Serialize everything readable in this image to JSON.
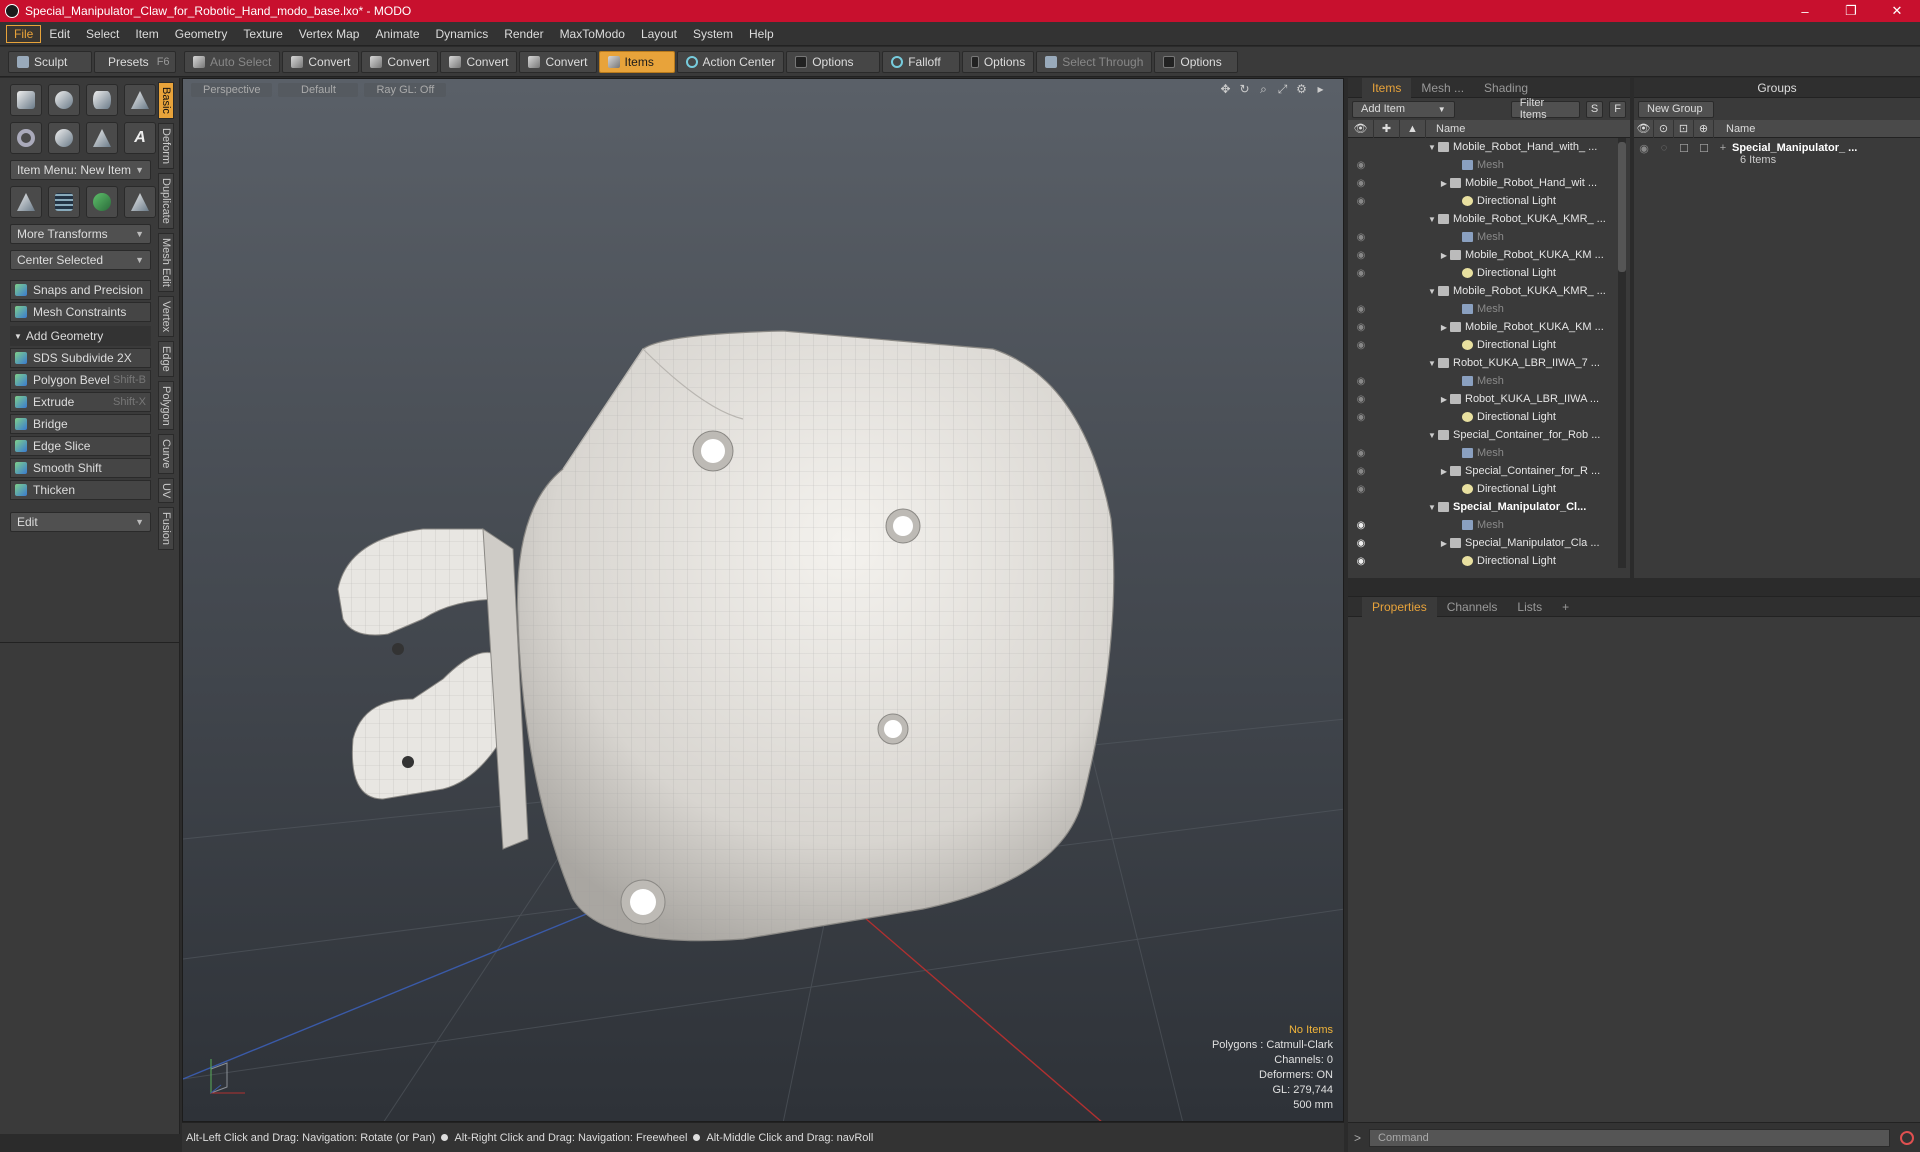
{
  "window": {
    "title": "Special_Manipulator_Claw_for_Robotic_Hand_modo_base.lxo* - MODO",
    "controls": [
      "–",
      "❐",
      "✕"
    ]
  },
  "menu": [
    "File",
    "Edit",
    "Select",
    "Item",
    "Geometry",
    "Texture",
    "Vertex Map",
    "Animate",
    "Dynamics",
    "Render",
    "MaxToModo",
    "Layout",
    "System",
    "Help"
  ],
  "toolbar": {
    "sculpt": "Sculpt",
    "presets": "Presets",
    "presets_key": "F6",
    "auto_select": "Auto Select",
    "convert1": "Convert",
    "convert2": "Convert",
    "convert3": "Convert",
    "convert4": "Convert",
    "items": "Items",
    "action_center": "Action Center",
    "options1": "Options",
    "falloff": "Falloff",
    "options2": "Options",
    "select_through": "Select Through",
    "options3": "Options"
  },
  "left": {
    "item_menu": "Item Menu: New Item",
    "more_transforms": "More Transforms",
    "center_selected": "Center Selected",
    "snaps": "Snaps and Precision",
    "mesh_constraints": "Mesh Constraints",
    "add_geometry": "Add Geometry",
    "tools": [
      {
        "label": "SDS Subdivide 2X",
        "key": ""
      },
      {
        "label": "Polygon Bevel",
        "key": "Shift-B"
      },
      {
        "label": "Extrude",
        "key": "Shift-X"
      },
      {
        "label": "Bridge",
        "key": ""
      },
      {
        "label": "Edge Slice",
        "key": ""
      },
      {
        "label": "Smooth Shift",
        "key": ""
      },
      {
        "label": "Thicken",
        "key": ""
      }
    ],
    "edit": "Edit",
    "vtabs": [
      "Basic",
      "Deform",
      "Duplicate",
      "Mesh Edit",
      "Vertex",
      "Edge",
      "Polygon",
      "Curve",
      "UV",
      "Fusion"
    ]
  },
  "viewport": {
    "view": "Perspective",
    "shading": "Default",
    "raygl": "Ray GL: Off",
    "info": {
      "items": "No Items",
      "polygons": "Polygons : Catmull-Clark",
      "channels": "Channels: 0",
      "deformers": "Deformers: ON",
      "gl": "GL: 279,744",
      "scale": "500 mm"
    }
  },
  "status": {
    "hint1": "Alt-Left Click and Drag: Navigation: Rotate (or Pan)",
    "hint2": "Alt-Right Click and Drag: Navigation: Freewheel",
    "hint3": "Alt-Middle Click and Drag: navRoll"
  },
  "items_panel": {
    "tabs": [
      "Items",
      "Mesh ...",
      "Shading"
    ],
    "add_item": "Add Item",
    "filter_items": "Filter Items",
    "s": "S",
    "f": "F",
    "name_col": "Name",
    "rows": [
      {
        "label": "Mobile_Robot_Hand_with_ ...",
        "kind": "scene",
        "indent": 0,
        "eye": false
      },
      {
        "label": "Mesh",
        "kind": "mesh",
        "indent": 2,
        "eye": false
      },
      {
        "label": "Mobile_Robot_Hand_wit ...",
        "kind": "item",
        "indent": 1,
        "eye": false
      },
      {
        "label": "Directional Light",
        "kind": "light",
        "indent": 2,
        "eye": false
      },
      {
        "label": "Mobile_Robot_KUKA_KMR_ ...",
        "kind": "scene",
        "indent": 0,
        "eye": false
      },
      {
        "label": "Mesh",
        "kind": "mesh",
        "indent": 2,
        "eye": false
      },
      {
        "label": "Mobile_Robot_KUKA_KM ...",
        "kind": "item",
        "indent": 1,
        "eye": false
      },
      {
        "label": "Directional Light",
        "kind": "light",
        "indent": 2,
        "eye": false
      },
      {
        "label": "Mobile_Robot_KUKA_KMR_ ...",
        "kind": "scene",
        "indent": 0,
        "eye": false
      },
      {
        "label": "Mesh",
        "kind": "mesh",
        "indent": 2,
        "eye": false
      },
      {
        "label": "Mobile_Robot_KUKA_KM ...",
        "kind": "item",
        "indent": 1,
        "eye": false
      },
      {
        "label": "Directional Light",
        "kind": "light",
        "indent": 2,
        "eye": false
      },
      {
        "label": "Robot_KUKA_LBR_IIWA_7 ...",
        "kind": "scene",
        "indent": 0,
        "eye": false
      },
      {
        "label": "Mesh",
        "kind": "mesh",
        "indent": 2,
        "eye": false
      },
      {
        "label": "Robot_KUKA_LBR_IIWA ...",
        "kind": "item",
        "indent": 1,
        "eye": false
      },
      {
        "label": "Directional Light",
        "kind": "light",
        "indent": 2,
        "eye": false
      },
      {
        "label": "Special_Container_for_Rob ...",
        "kind": "scene",
        "indent": 0,
        "eye": false
      },
      {
        "label": "Mesh",
        "kind": "mesh",
        "indent": 2,
        "eye": false
      },
      {
        "label": "Special_Container_for_R ...",
        "kind": "item",
        "indent": 1,
        "eye": false
      },
      {
        "label": "Directional Light",
        "kind": "light",
        "indent": 2,
        "eye": false
      },
      {
        "label": "Special_Manipulator_Cl...",
        "kind": "scene",
        "indent": 0,
        "eye": true
      },
      {
        "label": "Mesh",
        "kind": "mesh",
        "indent": 2,
        "eye": true
      },
      {
        "label": "Special_Manipulator_Cla ...",
        "kind": "item",
        "indent": 1,
        "eye": true
      },
      {
        "label": "Directional Light",
        "kind": "light",
        "indent": 2,
        "eye": true
      }
    ]
  },
  "groups_panel": {
    "title": "Groups",
    "new_group": "New Group",
    "name_col": "Name",
    "group_name": "Special_Manipulator_ ...",
    "group_count": "6 Items"
  },
  "props_panel": {
    "tabs": [
      "Properties",
      "Channels",
      "Lists",
      "+"
    ]
  },
  "command": {
    "placeholder": "Command"
  },
  "colors": {
    "title_bar": "#c8102e",
    "accent": "#e8a33a",
    "info_highlight": "#f2b53a"
  }
}
